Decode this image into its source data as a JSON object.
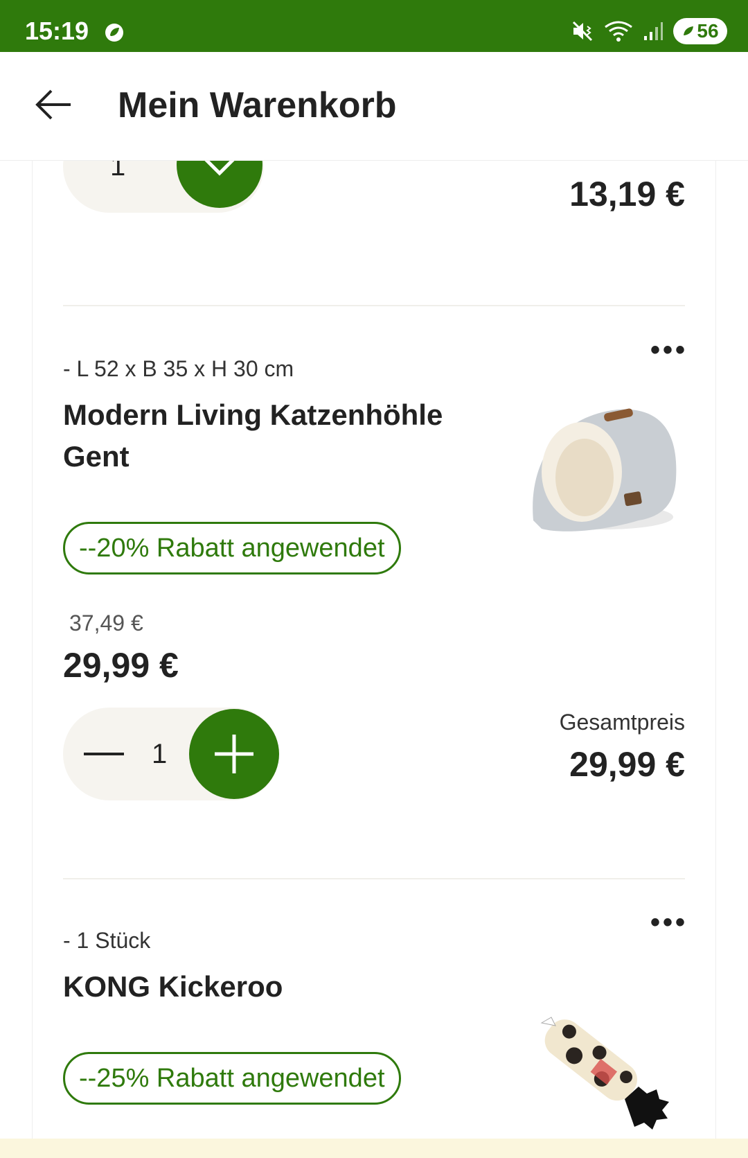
{
  "status_bar": {
    "time": "15:19",
    "battery": "56"
  },
  "header": {
    "title": "Mein Warenkorb"
  },
  "items": [
    {
      "quantity": "1",
      "total_price": "13,19 €"
    },
    {
      "spec": "- L 52 x B 35 x H 30 cm",
      "name": "Modern Living Katzenhöhle Gent",
      "badge": "--20% Rabatt angewendet",
      "old_price": "37,49 €",
      "price": "29,99 €",
      "quantity": "1",
      "total_label": "Gesamtpreis",
      "total_price": "29,99 €"
    },
    {
      "spec": "- 1 Stück",
      "name": "KONG Kickeroo",
      "badge": "--25% Rabatt angewendet"
    }
  ],
  "colors": {
    "brand_green": "#2f7a0c",
    "pill_bg": "#f6f4ef",
    "footer_bg": "#fbf6dd"
  },
  "icons": [
    "back-arrow-icon",
    "chevron-down-icon",
    "minus-icon",
    "plus-icon",
    "more-options-icon"
  ]
}
